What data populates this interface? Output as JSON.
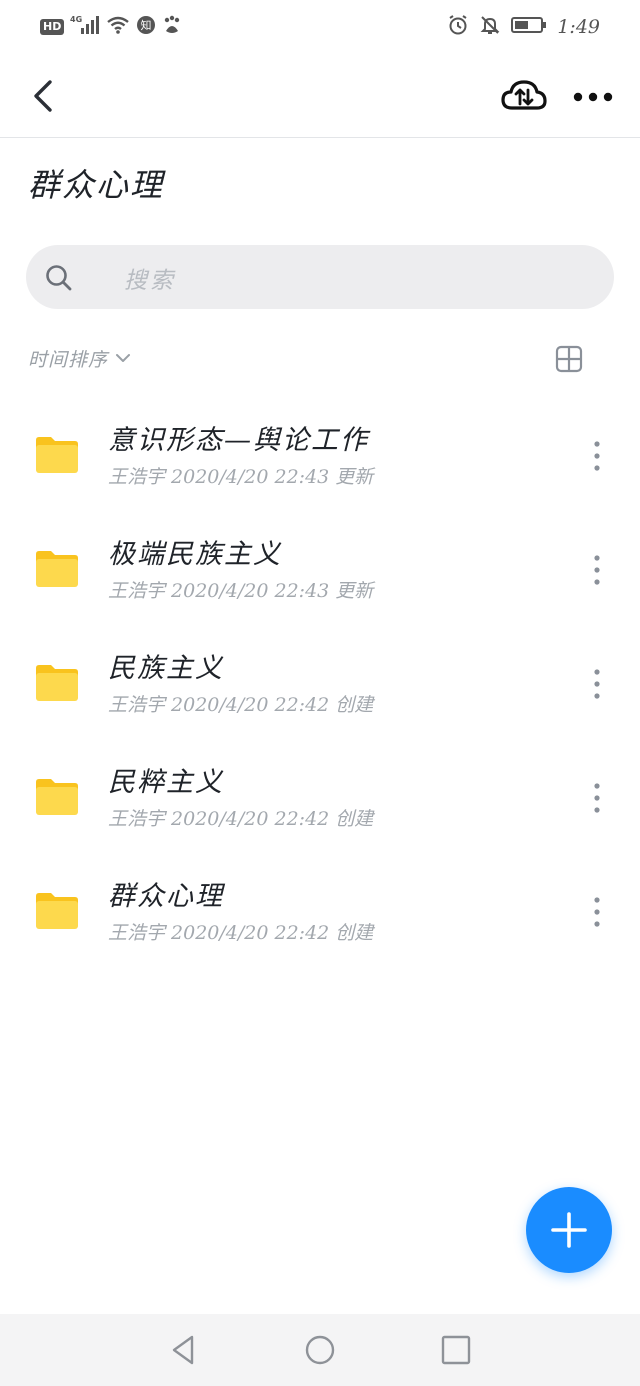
{
  "status_bar": {
    "hd_label": "HD",
    "network_label": "4G",
    "app_badge": "知",
    "time": "1:49"
  },
  "app_bar": {
    "back_icon": "chevron-left-icon",
    "cloud_icon": "cloud-transfer-icon",
    "more_icon": "more-horizontal-icon"
  },
  "page": {
    "title": "群众心理"
  },
  "search": {
    "placeholder": "搜索"
  },
  "sort": {
    "label": "时间排序"
  },
  "files": [
    {
      "name": "意识形态—舆论工作",
      "meta": "王浩宇 2020/4/20 22:43 更新"
    },
    {
      "name": "极端民族主义",
      "meta": "王浩宇 2020/4/20 22:43 更新"
    },
    {
      "name": "民族主义",
      "meta": "王浩宇 2020/4/20 22:42 创建"
    },
    {
      "name": "民粹主义",
      "meta": "王浩宇 2020/4/20 22:42 创建"
    },
    {
      "name": "群众心理",
      "meta": "王浩宇 2020/4/20 22:42 创建"
    }
  ],
  "colors": {
    "accent": "#1a8cff",
    "folder": "#f9c31e",
    "folder_body": "#fdd94d"
  }
}
